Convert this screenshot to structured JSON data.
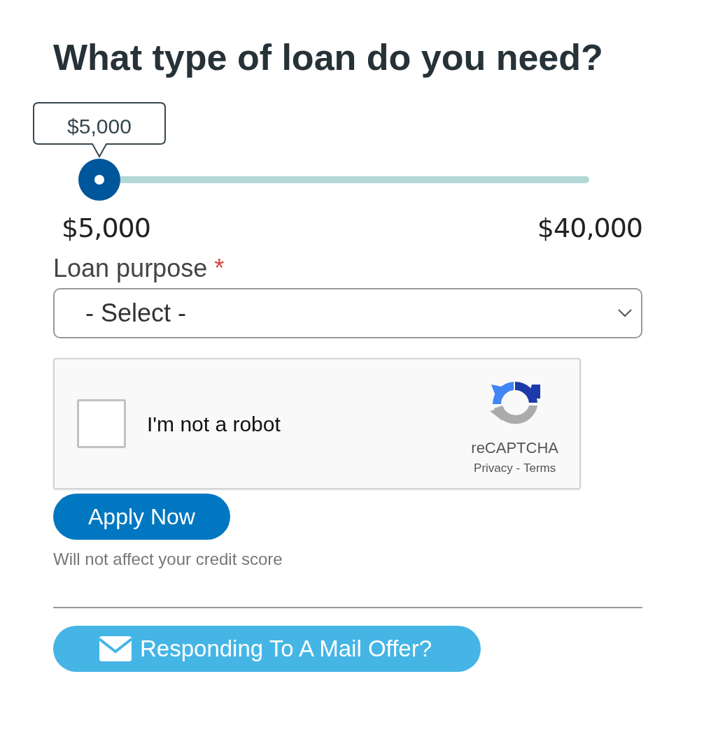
{
  "title": "What type of loan do you need?",
  "slider": {
    "tooltip": "$5,000",
    "min_label": "$5,000",
    "max_label": "$40,000"
  },
  "loan_purpose": {
    "label": "Loan purpose",
    "required_mark": "*",
    "value": "- Select -"
  },
  "captcha": {
    "label": "I'm not a robot",
    "checked": false,
    "brand": "reCAPTCHA",
    "privacy": "Privacy",
    "separator": " - ",
    "terms": "Terms"
  },
  "apply_button": "Apply Now",
  "note": "Will not affect your credit score",
  "mail_offer_button": "Responding To A Mail Offer?"
}
